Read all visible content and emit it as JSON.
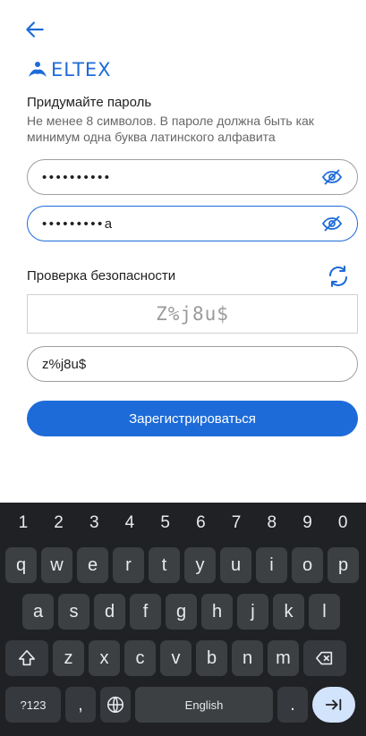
{
  "header": {
    "back_icon": "arrow-left-icon"
  },
  "logo": {
    "text": "ELTEX",
    "accent_color": "#1d6bd9"
  },
  "form": {
    "heading": "Придумайте пароль",
    "hint": "Не менее 8 символов. В пароле должна быть как минимум одна буква латинского алфавита",
    "password_value": "••••••••••",
    "confirm_value": "•••••••••a",
    "security_label": "Проверка безопасности",
    "captcha_text": "Z%j8u$",
    "captcha_input_value": "z%j8u$",
    "register_label": "Зарегистрироваться"
  },
  "keyboard": {
    "numbers": [
      "1",
      "2",
      "3",
      "4",
      "5",
      "6",
      "7",
      "8",
      "9",
      "0"
    ],
    "row1": [
      "q",
      "w",
      "e",
      "r",
      "t",
      "y",
      "u",
      "i",
      "o",
      "p"
    ],
    "row2": [
      "a",
      "s",
      "d",
      "f",
      "g",
      "h",
      "j",
      "k",
      "l"
    ],
    "row3": [
      "z",
      "x",
      "c",
      "v",
      "b",
      "n",
      "m"
    ],
    "symbols_label": "?123",
    "comma": ",",
    "space_label": "English",
    "period": "."
  }
}
